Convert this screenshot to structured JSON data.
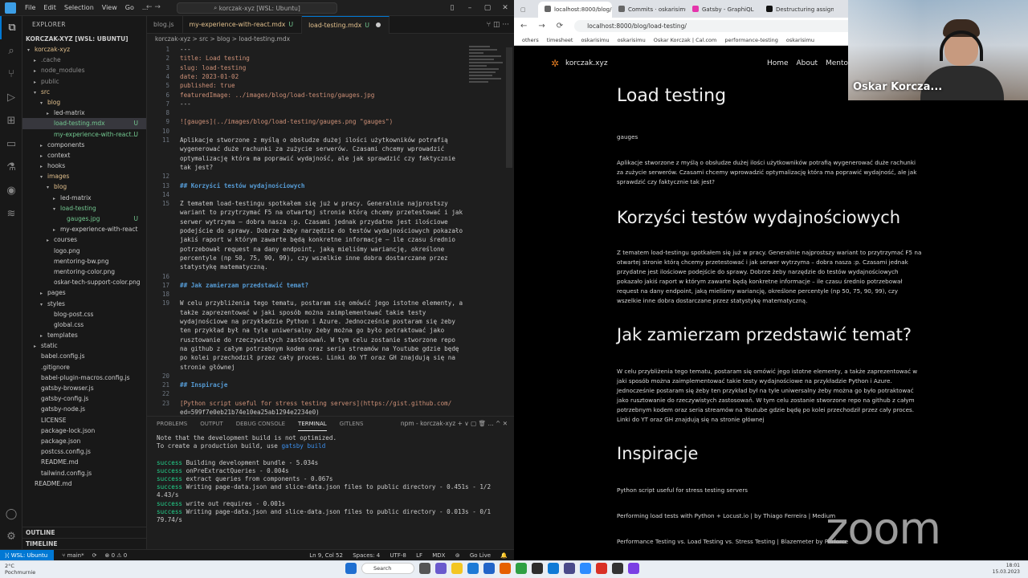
{
  "vscode": {
    "menu": [
      "File",
      "Edit",
      "Selection",
      "View",
      "Go",
      "..."
    ],
    "search_text": "korczak-xyz [WSL: Ubuntu]",
    "explorer_header": "EXPLORER",
    "root_label": "KORCZAK-XYZ [WSL: UBUNTU]",
    "tree": [
      {
        "label": "korczak-xyz",
        "depth": 0,
        "chev": "v",
        "cls": "mod"
      },
      {
        "label": ".cache",
        "depth": 1,
        "chev": ">",
        "cls": "dim"
      },
      {
        "label": "node_modules",
        "depth": 1,
        "chev": ">",
        "cls": "dim"
      },
      {
        "label": "public",
        "depth": 1,
        "chev": ">",
        "cls": "dim"
      },
      {
        "label": "src",
        "depth": 1,
        "chev": "v",
        "cls": "mod"
      },
      {
        "label": "blog",
        "depth": 2,
        "chev": "v",
        "cls": "mod"
      },
      {
        "label": "led-matrix",
        "depth": 3,
        "chev": ">",
        "cls": ""
      },
      {
        "label": "load-testing.mdx",
        "depth": 3,
        "chev": "",
        "cls": "sel untr",
        "badge": "U"
      },
      {
        "label": "my-experience-with-react...",
        "depth": 3,
        "chev": "",
        "cls": "untr",
        "badge": "U"
      },
      {
        "label": "components",
        "depth": 2,
        "chev": ">",
        "cls": ""
      },
      {
        "label": "context",
        "depth": 2,
        "chev": ">",
        "cls": ""
      },
      {
        "label": "hooks",
        "depth": 2,
        "chev": ">",
        "cls": ""
      },
      {
        "label": "images",
        "depth": 2,
        "chev": "v",
        "cls": "mod"
      },
      {
        "label": "blog",
        "depth": 3,
        "chev": "v",
        "cls": "mod"
      },
      {
        "label": "led-matrix",
        "depth": 4,
        "chev": ">",
        "cls": ""
      },
      {
        "label": "load-testing",
        "depth": 4,
        "chev": "v",
        "cls": "untr"
      },
      {
        "label": "gauges.jpg",
        "depth": 5,
        "chev": "",
        "cls": "untr",
        "badge": "U"
      },
      {
        "label": "my-experience-with-react",
        "depth": 4,
        "chev": ">",
        "cls": ""
      },
      {
        "label": "courses",
        "depth": 3,
        "chev": ">",
        "cls": ""
      },
      {
        "label": "logo.png",
        "depth": 3,
        "chev": "",
        "cls": ""
      },
      {
        "label": "mentoring-bw.png",
        "depth": 3,
        "chev": "",
        "cls": ""
      },
      {
        "label": "mentoring-color.png",
        "depth": 3,
        "chev": "",
        "cls": ""
      },
      {
        "label": "oskar-tech-support-color.png",
        "depth": 3,
        "chev": "",
        "cls": ""
      },
      {
        "label": "pages",
        "depth": 2,
        "chev": ">",
        "cls": ""
      },
      {
        "label": "styles",
        "depth": 2,
        "chev": "v",
        "cls": ""
      },
      {
        "label": "blog-post.css",
        "depth": 3,
        "chev": "",
        "cls": ""
      },
      {
        "label": "global.css",
        "depth": 3,
        "chev": "",
        "cls": ""
      },
      {
        "label": "templates",
        "depth": 2,
        "chev": ">",
        "cls": ""
      },
      {
        "label": "static",
        "depth": 1,
        "chev": ">",
        "cls": ""
      },
      {
        "label": "babel.config.js",
        "depth": 1,
        "chev": "",
        "cls": ""
      },
      {
        "label": ".gitignore",
        "depth": 1,
        "chev": "",
        "cls": ""
      },
      {
        "label": "babel-plugin-macros.config.js",
        "depth": 1,
        "chev": "",
        "cls": ""
      },
      {
        "label": "gatsby-browser.js",
        "depth": 1,
        "chev": "",
        "cls": ""
      },
      {
        "label": "gatsby-config.js",
        "depth": 1,
        "chev": "",
        "cls": ""
      },
      {
        "label": "gatsby-node.js",
        "depth": 1,
        "chev": "",
        "cls": ""
      },
      {
        "label": "LICENSE",
        "depth": 1,
        "chev": "",
        "cls": ""
      },
      {
        "label": "package-lock.json",
        "depth": 1,
        "chev": "",
        "cls": ""
      },
      {
        "label": "package.json",
        "depth": 1,
        "chev": "",
        "cls": ""
      },
      {
        "label": "postcss.config.js",
        "depth": 1,
        "chev": "",
        "cls": ""
      },
      {
        "label": "README.md",
        "depth": 1,
        "chev": "",
        "cls": ""
      },
      {
        "label": "tailwind.config.js",
        "depth": 1,
        "chev": "",
        "cls": ""
      },
      {
        "label": "README.md",
        "depth": 0,
        "chev": "",
        "cls": ""
      }
    ],
    "outline_label": "OUTLINE",
    "timeline_label": "TIMELINE",
    "tabs": [
      {
        "label": "blog.js",
        "suffix": "",
        "active": false
      },
      {
        "label": "my-experience-with-react.mdx",
        "suffix": "U",
        "active": false
      },
      {
        "label": "load-testing.mdx",
        "suffix": "U",
        "active": true
      }
    ],
    "breadcrumb": "korczak-xyz > src > blog > load-testing.mdx",
    "code_lines": [
      {
        "n": "1",
        "t": "---"
      },
      {
        "n": "2",
        "t": "title: Load testing"
      },
      {
        "n": "3",
        "t": "slug: load-testing"
      },
      {
        "n": "4",
        "t": "date: 2023-01-02"
      },
      {
        "n": "5",
        "t": "published: true"
      },
      {
        "n": "6",
        "t": "featuredImage: ../images/blog/load-testing/gauges.jpg"
      },
      {
        "n": "7",
        "t": "---"
      },
      {
        "n": "8",
        "t": ""
      },
      {
        "n": "9",
        "t": "![gauges](../images/blog/load-testing/gauges.png \"gauges\")"
      },
      {
        "n": "10",
        "t": ""
      },
      {
        "n": "11",
        "t": "Aplikacje stworzone z myślą o obsłudze dużej ilości użytkowników potrafią"
      },
      {
        "n": "",
        "t": "wygenerować duże rachunki za zużycie serwerów. Czasami chcemy wprowadzić"
      },
      {
        "n": "",
        "t": "optymalizację która ma poprawić wydajność, ale jak sprawdzić czy faktycznie"
      },
      {
        "n": "",
        "t": "tak jest?"
      },
      {
        "n": "12",
        "t": ""
      },
      {
        "n": "13",
        "t": "## Korzyści testów wydajnościowych"
      },
      {
        "n": "14",
        "t": ""
      },
      {
        "n": "15",
        "t": "Z tematem load-testingu spotkałem się już w pracy. Generalnie najprostszy"
      },
      {
        "n": "",
        "t": "wariant to przytrzymać F5 na otwartej stronie którą chcemy przetestować i jak"
      },
      {
        "n": "",
        "t": "serwer wytrzyma – dobra nasza :p. Czasami jednak przydatne jest ilościowe"
      },
      {
        "n": "",
        "t": "podejście do sprawy. Dobrze żeby narzędzie do testów wydajnościowych pokazało"
      },
      {
        "n": "",
        "t": "jakiś raport w którym zawarte będą konkretne informacje – ile czasu średnio"
      },
      {
        "n": "",
        "t": "potrzebował request na dany endpoint, jaką mieliśmy wariancję, określone"
      },
      {
        "n": "",
        "t": "percentyle (np 50, 75, 90, 99), czy wszelkie inne dobra dostarczane przez"
      },
      {
        "n": "",
        "t": "statystykę matematyczną."
      },
      {
        "n": "16",
        "t": ""
      },
      {
        "n": "17",
        "t": "## Jak zamierzam przedstawić temat?"
      },
      {
        "n": "18",
        "t": ""
      },
      {
        "n": "19",
        "t": "W celu przybliżenia tego tematu, postaram się omówić jego istotne elementy, a"
      },
      {
        "n": "",
        "t": "także zaprezentować w jaki sposób można zaimplementować takie testy"
      },
      {
        "n": "",
        "t": "wydajnościowe na przykładzie Python i Azure. Jednocześnie postaram się żeby"
      },
      {
        "n": "",
        "t": "ten przykład był na tyle uniwersalny żeby można go było potraktować jako"
      },
      {
        "n": "",
        "t": "rusztowanie do rzeczywistych zastosowań. W tym celu zostanie stworzone repo"
      },
      {
        "n": "",
        "t": "na github z całym potrzebnym kodem oraz seria streamów na Youtube gdzie będę"
      },
      {
        "n": "",
        "t": "po kolei przechodził przez cały proces. Linki do YT oraz GH znajdują się na"
      },
      {
        "n": "",
        "t": "stronie głównej"
      },
      {
        "n": "20",
        "t": ""
      },
      {
        "n": "21",
        "t": "## Inspiracje"
      },
      {
        "n": "22",
        "t": ""
      },
      {
        "n": "23",
        "t": "[Python script useful for stress testing servers](https://gist.github.com/"
      },
      {
        "n": "",
        "t": "ed=599f7e0eb21b74e10ea25ab1294e2234e0)"
      }
    ],
    "panel_tabs": [
      "PROBLEMS",
      "OUTPUT",
      "DEBUG CONSOLE",
      "TERMINAL",
      "GITLENS"
    ],
    "panel_right": "npm - korczak-xyz  +  ∨  ▢  🗑  ...  ^  ✕",
    "terminal": [
      {
        "pre": "",
        "main": "Note that the development build is not optimized."
      },
      {
        "pre": "",
        "main": "To create a production build, use ",
        "cmd": "gatsby build"
      },
      {
        "pre": "",
        "main": ""
      },
      {
        "pre": "success",
        "main": " Building development bundle - 5.034s"
      },
      {
        "pre": "success",
        "main": " onPreExtractQueries - 0.004s"
      },
      {
        "pre": "success",
        "main": " extract queries from components - 0.067s"
      },
      {
        "pre": "success",
        "main": " Writing page-data.json and slice-data.json files to public directory - 0.451s - 1/2"
      },
      {
        "pre": "",
        "main": "4.43/s"
      },
      {
        "pre": "success",
        "main": " write out requires - 0.001s"
      },
      {
        "pre": "success",
        "main": " Writing page-data.json and slice-data.json files to public directory - 0.013s - 0/1"
      },
      {
        "pre": "",
        "main": "79.74/s"
      }
    ],
    "status": {
      "remote": "WSL: Ubuntu",
      "branch": "main*",
      "problems": "⊗ 0 ⚠ 0",
      "position": "Ln 9, Col 52",
      "spaces": "Spaces: 4",
      "encoding": "UTF-8",
      "eol": "LF",
      "lang": "MDX",
      "golive": "Go Live"
    }
  },
  "browser": {
    "tabs": [
      {
        "label": "localhost:8000/blog/lo...",
        "active": true
      },
      {
        "label": "Commits · oskarisimu...",
        "active": false
      },
      {
        "label": "Gatsby - GraphiQL",
        "active": false
      },
      {
        "label": "Destructuring assignm...",
        "active": false
      }
    ],
    "url": "localhost:8000/blog/load-testing/",
    "bookmarks": [
      "others",
      "timesheet",
      "oskarisimu",
      "oskarisimu",
      "Oskar Korczak | Cal.com",
      "performance-testing",
      "oskarisimu"
    ],
    "site": {
      "name": "korczak.xyz",
      "nav": [
        "Home",
        "About",
        "Mentorin"
      ]
    },
    "article": {
      "h1": "Load testing",
      "img_alt": "gauges",
      "p1": "Aplikacje stworzone z myślą o obsłudze dużej ilości użytkowników potrafią wygenerować duże rachunki za zużycie serwerów. Czasami chcemy wprowadzić optymalizację która ma poprawić wydajność, ale jak sprawdzić czy faktycznie tak jest?",
      "h2a": "Korzyści testów wydajnościowych",
      "p2": "Z tematem load-testingu spotkałem się już w pracy. Generalnie najprostszy wariant to przytrzymać F5 na otwartej stronie którą chcemy przetestować i jak serwer wytrzyma – dobra nasza :p. Czasami jednak przydatne jest ilościowe podejście do sprawy. Dobrze żeby narzędzie do testów wydajnościowych pokazało jakiś raport w którym zawarte będą konkretne informacje – ile czasu średnio potrzebował request na dany endpoint, jaką mieliśmy wariancję, określone percentyle (np 50, 75, 90, 99), czy wszelkie inne dobra dostarczane przez statystykę matematyczną.",
      "h2b": "Jak zamierzam przedstawić temat?",
      "p3": "W celu przybliżenia tego tematu, postaram się omówić jego istotne elementy, a także zaprezentować w jaki sposób można zaimplementować takie testy wydajnościowe na przykładzie Python i Azure. Jednocześnie postaram się żeby ten przykład był na tyle uniwersalny żeby można go było potraktować jako rusztowanie do rzeczywistych zastosowań. W tym celu zostanie stworzone repo na github z całym potrzebnym kodem oraz seria streamów na Youtube gdzie będę po kolei przechodził przez cały proces. Linki do YT oraz GH znajdują się na stronie głównej",
      "h2c": "Inspiracje",
      "l1": "Python script useful for stress testing servers",
      "l2": "Performing load tests with Python + Locust.io | by Thiago Ferreira | Medium",
      "l3": "Performance Testing vs. Load Testing vs. Stress Testing | Blazemeter by Perforce"
    },
    "watermark": "zoom",
    "participant": "Oskar Korcza..."
  },
  "taskbar": {
    "temp": "2°C",
    "weather": "Pochmurnie",
    "search": "Search",
    "time": "18:01",
    "date": "15.03.2023"
  }
}
